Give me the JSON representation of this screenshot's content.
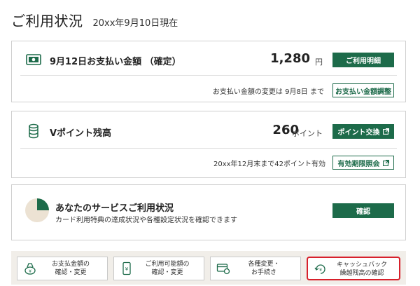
{
  "header": {
    "title": "ご利用状況",
    "as_of": "20xx年9月10日現在"
  },
  "payment": {
    "label": "9月12日お支払い金額 （確定）",
    "amount": "1,280",
    "unit": "円",
    "details_button": "ご利用明細",
    "note": "お支払い金額の変更は 9月8日 まで",
    "adjust_button": "お支払い金額調整",
    "icon": "money-card-icon"
  },
  "points": {
    "label": "Vポイント残高",
    "amount": "260",
    "unit": "ポイント",
    "exchange_button": "ポイント交換",
    "note": "20xx年12月末まで42ポイント有効",
    "expiry_button": "有効期限照会",
    "icon": "coin-stack-icon"
  },
  "services": {
    "title": "あなたのサービスご利用状況",
    "subtitle": "カード利用特典の達成状況や各種設定状況を確認できます",
    "confirm_button": "確認",
    "pie_fraction": 0.25,
    "icon": "pie-chart-icon"
  },
  "quick_links": [
    {
      "line1": "お支払金額の",
      "line2": "確認・変更",
      "icon": "wallet-icon"
    },
    {
      "line1": "ご利用可能額の",
      "line2": "確認・変更",
      "icon": "phone-yen-icon"
    },
    {
      "line1": "各種変更・",
      "line2": "お手続き",
      "icon": "card-settings-icon"
    },
    {
      "line1": "キャッシュバック",
      "line2": "繰越残高の確認",
      "icon": "cashback-icon"
    }
  ],
  "colors": {
    "brand_green": "#1d6b4a",
    "highlight_red": "#d7202b",
    "bar_background": "#f1eee9"
  }
}
